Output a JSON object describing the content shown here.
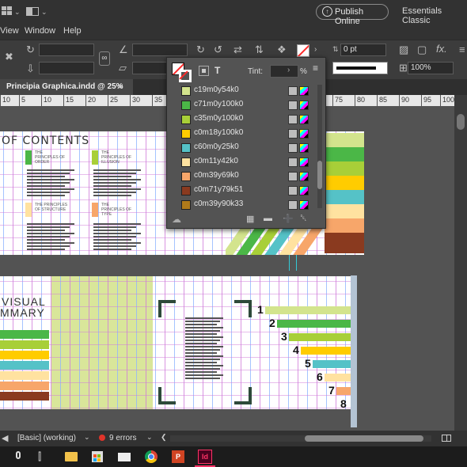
{
  "app": {
    "publish_label": "Publish Online",
    "workspace": "Essentials Classic"
  },
  "menu": [
    "View",
    "Window",
    "Help"
  ],
  "control": {
    "stroke_weight": "0 pt",
    "zoom": "100%",
    "fx_label": "fx."
  },
  "document_tab": {
    "title": "Principia Graphica.indd @ 25%",
    "close": "×"
  },
  "ruler_ticks": [
    "10",
    "5",
    "10",
    "15",
    "20",
    "25",
    "30",
    "35",
    "40",
    "75",
    "80",
    "85",
    "90",
    "95",
    "100",
    "105",
    "110"
  ],
  "swatches_panel": {
    "tint_label": "Tint:",
    "tint_unit": "%",
    "fill_icon": "fill-stroke-icon",
    "swatches": [
      {
        "name": "c19m0y54k0",
        "color": "#d3e48d"
      },
      {
        "name": "c71m0y100k0",
        "color": "#4bb747"
      },
      {
        "name": "c35m0y100k0",
        "color": "#a8cf38"
      },
      {
        "name": "c0m18y100k0",
        "color": "#ffcc00"
      },
      {
        "name": "c60m0y25k0",
        "color": "#55c2c7"
      },
      {
        "name": "c0m11y42k0",
        "color": "#ffe2a0"
      },
      {
        "name": "c0m39y69k0",
        "color": "#f7a66a"
      },
      {
        "name": "c0m71y79k51",
        "color": "#8a3a1f"
      },
      {
        "name": "c0m39y90k33",
        "color": "#b07a1a"
      }
    ]
  },
  "spread1": {
    "heading": "OF CONTENTS",
    "items": [
      {
        "label": "THE PRINCIPLES OF ORDER",
        "color": "#a8cf38"
      },
      {
        "label": "THE PRINCIPLES OF ILLUSION",
        "color": "#a8cf38"
      },
      {
        "label": "THE PRINCIPLES OF STRUCTURE",
        "color": "#ffe2a0"
      },
      {
        "label": "THE PRINCIPLES OF TYPE",
        "color": "#f7a66a"
      }
    ]
  },
  "spread2": {
    "heading_line1": "VISUAL",
    "heading_line2": "MMARY",
    "numbers": [
      "1",
      "2",
      "3",
      "4",
      "5",
      "6",
      "7",
      "8"
    ]
  },
  "status": {
    "style": "[Basic] (working)",
    "errors": "9 errors"
  },
  "accent": "#ff2a2a"
}
